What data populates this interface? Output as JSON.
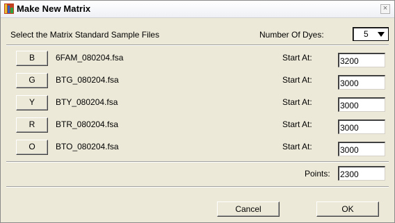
{
  "window": {
    "title": "Make New Matrix",
    "close_label": "×"
  },
  "header": {
    "instruction": "Select the Matrix Standard Sample Files",
    "dyes_label": "Number Of Dyes:",
    "dyes_value": "5"
  },
  "rows": [
    {
      "dye": "B",
      "file": "6FAM_080204.fsa",
      "start_label": "Start At:",
      "start_value": "3200"
    },
    {
      "dye": "G",
      "file": "BTG_080204.fsa",
      "start_label": "Start At:",
      "start_value": "3000"
    },
    {
      "dye": "Y",
      "file": "BTY_080204.fsa",
      "start_label": "Start At:",
      "start_value": "3000"
    },
    {
      "dye": "R",
      "file": "BTR_080204.fsa",
      "start_label": "Start At:",
      "start_value": "3000"
    },
    {
      "dye": "O",
      "file": "BTO_080204.fsa",
      "start_label": "Start At:",
      "start_value": "3000"
    }
  ],
  "points": {
    "label": "Points:",
    "value": "2300"
  },
  "buttons": {
    "cancel": "Cancel",
    "ok": "OK"
  }
}
